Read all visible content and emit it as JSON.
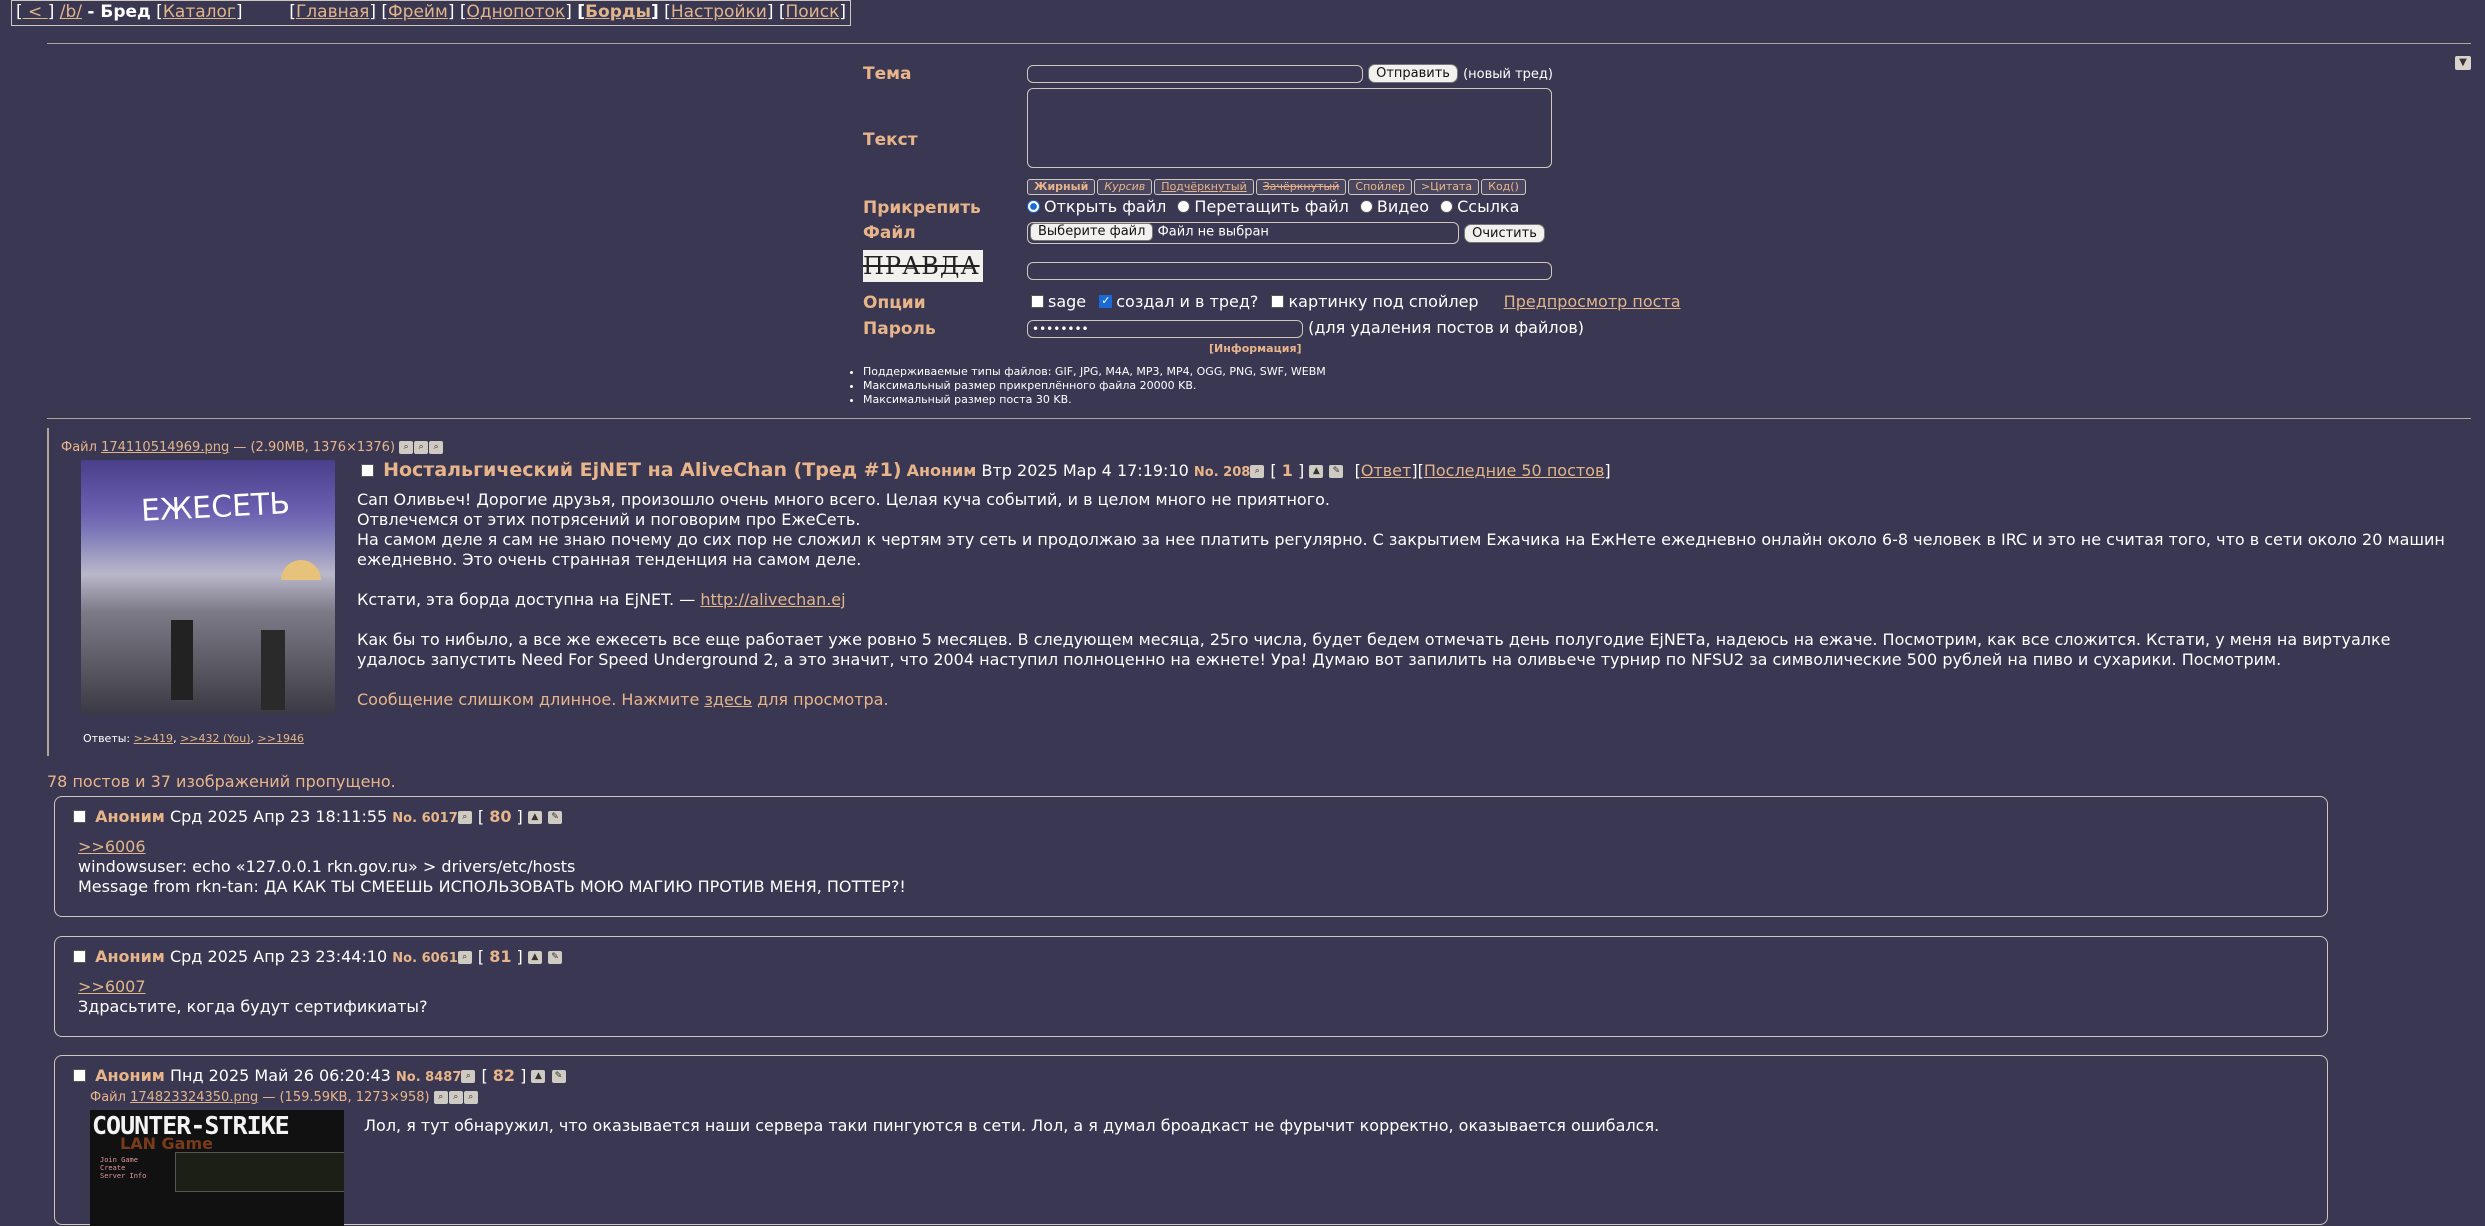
{
  "topnav": {
    "back": "<",
    "board_code": "/b/",
    "board_name": "- Бред",
    "catalog": "Каталог",
    "main": "Главная",
    "frame": "Фрейм",
    "single": "Однопоток",
    "boards": "Борды",
    "settings": "Настройки",
    "search": "Поиск"
  },
  "form": {
    "subject_label": "Тема",
    "submit_label": "Отправить",
    "new_thread_note": "(новый тред)",
    "text_label": "Текст",
    "markup_buttons": [
      "Жирный",
      "Курсив",
      "Подчёркнутый",
      "Зачёркнутый",
      "Спойлер",
      ">Цитата",
      "Код()"
    ],
    "attach_label": "Прикрепить",
    "attach_options": [
      "Открыть файл",
      "Перетащить файл",
      "Видео",
      "Ссылка"
    ],
    "file_label": "Файл",
    "choose_file": "Выберите файл",
    "no_file": "Файл не выбран",
    "clear": "Очистить",
    "captcha_text": "ПРАВДА",
    "options_label": "Опции",
    "opt_sage": "sage",
    "opt_created": "создал и в тред?",
    "opt_spoiler": "картинку под спойлер",
    "preview": "Предпросмотр поста",
    "password_label": "Пароль",
    "password_value": "••••••••",
    "password_note": "(для удаления постов и файлов)",
    "info": "[Информация]"
  },
  "rules": [
    "Поддерживаемые типы файлов: GIF, JPG, M4A, MP3, MP4, OGG, PNG, SWF, WEBM",
    "Максимальный размер прикреплённого файла 20000 KB.",
    "Максимальный размер поста 30 KB."
  ],
  "op": {
    "file_prefix": "Файл",
    "file_name": "174110514969.png",
    "file_meta": "— (2.90MB, 1376×1376)",
    "subject": "Ностальгический EjNET на AliveChan (Тред #1)",
    "name": "Аноним",
    "date": "Втр 2025 Мар 4 17:19:10",
    "no": "No. 208",
    "reply_count": "1",
    "reply_link": "Ответ",
    "last50": "Последние 50 постов",
    "thumb_sign": "ЕЖЕСЕТЬ",
    "lines": [
      "Сап Оливьеч! Дорогие друзья, произошло очень много всего. Целая куча событий, и в целом много не приятного.",
      "Отвлечемся от этих потрясений и поговорим про ЕжеСеть.",
      "На самом деле я сам не знаю почему до сих пор не сложил к чертям эту сеть и продолжаю за нее платить регулярно. С закрытием Ежачика на ЕжНете ежедневно онлайн около 6-8 человек в IRC и это не считая того, что в сети около 20 машин",
      "ежедневно. Это очень странная тенденция на самом деле."
    ],
    "board_note_prefix": "Кстати, эта борда доступна на EjNET. —",
    "board_link": "http://alivechan.ej",
    "para2": [
      "Как бы то нибыло, а все же ежесеть все еще работает уже ровно 5 месяцев. В следующем месяца, 25го числа, будет бедем отмечать день полугодие EjNETа, надеюсь на ежаче. Посмотрим, как все сложится. Кстати, у меня на виртуалке",
      "удалось запустить Need For Speed Underground 2, а это значит, что 2004 наступил полноценно на ежнете! Ура! Думаю вот запилить на оливьече турнир по NFSU2 за символические 500 рублей на пиво и сухарики. Посмотрим."
    ],
    "too_long_prefix": "Сообщение слишком длинное. Нажмите",
    "too_long_link": "здесь",
    "too_long_suffix": "для просмотра.",
    "answers_label": "Ответы:",
    "answers": [
      ">>419",
      ">>432 (You)",
      ">>1946"
    ]
  },
  "omitted": "78 постов и 37 изображений пропущено.",
  "replies": [
    {
      "name": "Аноним",
      "date": "Срд 2025 Апр 23 18:11:55",
      "no": "No. 6017",
      "count": "80",
      "quote": ">>6006",
      "lines": [
        "windowsuser: echo «127.0.0.1 rkn.gov.ru» > drivers/etc/hosts",
        "Message from rkn-tan: ДА КАК ТЫ СМЕЕШЬ ИСПОЛЬЗОВАТЬ МОЮ МАГИЮ ПРОТИВ МЕНЯ, ПОТТЕР?!"
      ]
    },
    {
      "name": "Аноним",
      "date": "Срд 2025 Апр 23 23:44:10",
      "no": "No. 6061",
      "count": "81",
      "quote": ">>6007",
      "lines": [
        "Здрасьтите, когда будут сертификиаты?"
      ]
    },
    {
      "name": "Аноним",
      "date": "Пнд 2025 Май 26 06:20:43",
      "no": "No. 8487",
      "count": "82",
      "file_prefix": "Файл",
      "file_name": "174823324350.png",
      "file_meta": "— (159.59KB, 1273×958)",
      "thumb_title": "COUNTER-STRIKE",
      "thumb_sub": "LAN Game",
      "thumb_menu": [
        "Join Game",
        "Create",
        "Server Info"
      ],
      "lines": [
        "Лол, я тут обнаружил, что оказывается наши сервера таки пингуются в сети. Лол, а я думал броадкаст не фурычит корректно, оказывается ошибался."
      ]
    }
  ]
}
